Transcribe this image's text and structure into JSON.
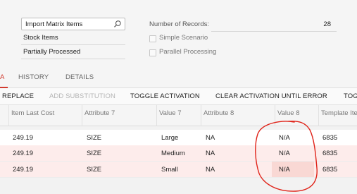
{
  "filters": {
    "selection_value": "Import Matrix Items",
    "item_class": "Stock Items",
    "status": "Partially Processed",
    "number_of_records_label": "Number of Records:",
    "number_of_records_value": "28",
    "simple_scenario_label": "Simple Scenario",
    "parallel_processing_label": "Parallel Processing"
  },
  "tabs": {
    "active_fragment": "A",
    "history": "HISTORY",
    "details": "DETAILS"
  },
  "toolbar": {
    "replace": "REPLACE",
    "add_substitution": "ADD SUBSTITUTION",
    "toggle_activation": "TOGGLE ACTIVATION",
    "clear_activation": "CLEAR ACTIVATION UNTIL ERROR",
    "toggle_fragment": "TOG"
  },
  "grid": {
    "columns": [
      "Item Last Cost",
      "Attribute 7",
      "Value 7",
      "Attribute 8",
      "Value 8",
      "Template Ite"
    ],
    "rows": [
      {
        "last_cost": "249.19",
        "attr7": "SIZE",
        "val7": "Large",
        "attr8": "NA",
        "val8": "N/A",
        "template": "6835"
      },
      {
        "last_cost": "249.19",
        "attr7": "SIZE",
        "val7": "Medium",
        "attr8": "NA",
        "val8": "N/A",
        "template": "6835"
      },
      {
        "last_cost": "249.19",
        "attr7": "SIZE",
        "val7": "Small",
        "attr8": "NA",
        "val8": "N/A",
        "template": "6835"
      }
    ]
  },
  "colors": {
    "accent": "#d13b2f",
    "annotation": "#e0241a",
    "selected_row": "#fdeceb"
  }
}
